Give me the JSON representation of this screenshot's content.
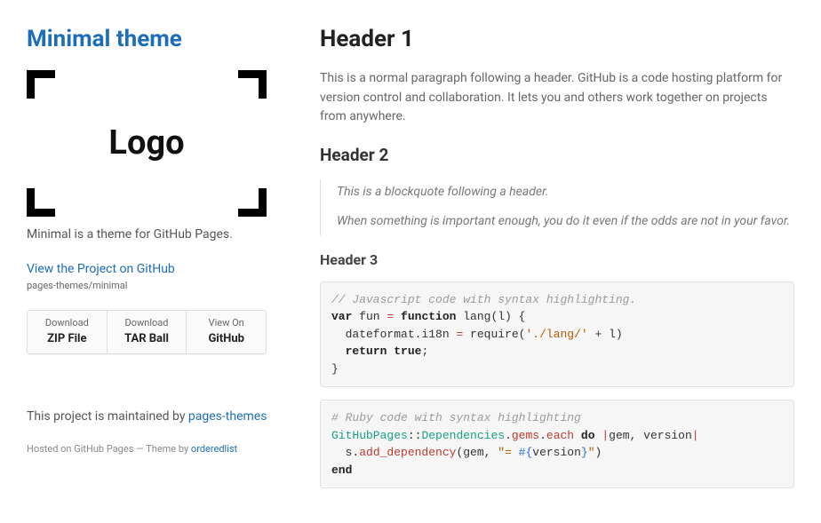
{
  "sidebar": {
    "title": "Minimal theme",
    "logo_text": "Logo",
    "tagline": "Minimal is a theme for GitHub Pages.",
    "gh_link_text": "View the Project on GitHub",
    "gh_repo": "pages-themes/minimal",
    "buttons": [
      {
        "small": "Download",
        "big": "ZIP File"
      },
      {
        "small": "Download",
        "big": "TAR Ball"
      },
      {
        "small": "View On",
        "big": "GitHub"
      }
    ],
    "maintained_prefix": "This project is maintained by ",
    "maintained_link": "pages-themes",
    "footer_prefix": "Hosted on GitHub Pages — Theme by ",
    "footer_link": "orderedlist"
  },
  "content": {
    "h1": "Header 1",
    "p1": "This is a normal paragraph following a header. GitHub is a code hosting platform for version control and collaboration. It lets you and others work together on projects from anywhere.",
    "h2": "Header 2",
    "bq1": "This is a blockquote following a header.",
    "bq2": "When something is important enough, you do it even if the odds are not in your favor.",
    "h3": "Header 3",
    "code_js": {
      "comment": "// Javascript code with syntax highlighting.",
      "kw_var": "var",
      "name_fun": " fun ",
      "op_eq": "=",
      "kw_function": " function",
      "rest1": " lang(l) {",
      "line2a": "  dateformat.i18n ",
      "op_eq2": "=",
      "line2b": " require(",
      "str": "'./lang/'",
      "line2c": " + l)",
      "indent": "  ",
      "kw_return": "return",
      "kw_true": " true",
      "semi": ";",
      "close": "}"
    },
    "code_rb": {
      "comment": "# Ruby code with syntax highlighting",
      "ns": "GitHubPages",
      "sep1": "::",
      "dep": "Dependencies",
      "dot1": ".",
      "gems": "gems",
      "dot2": ".",
      "each": "each",
      "do": " do ",
      "pipe1": "|",
      "args": "gem, version",
      "pipe2": "|",
      "indent": "  s.",
      "add": "add_dependency",
      "paren_open": "(gem, ",
      "str_open": "\"= ",
      "interp": "#{",
      "ver": "version",
      "interp_close": "}",
      "str_close": "\"",
      "paren_close": ")",
      "end": "end"
    }
  }
}
